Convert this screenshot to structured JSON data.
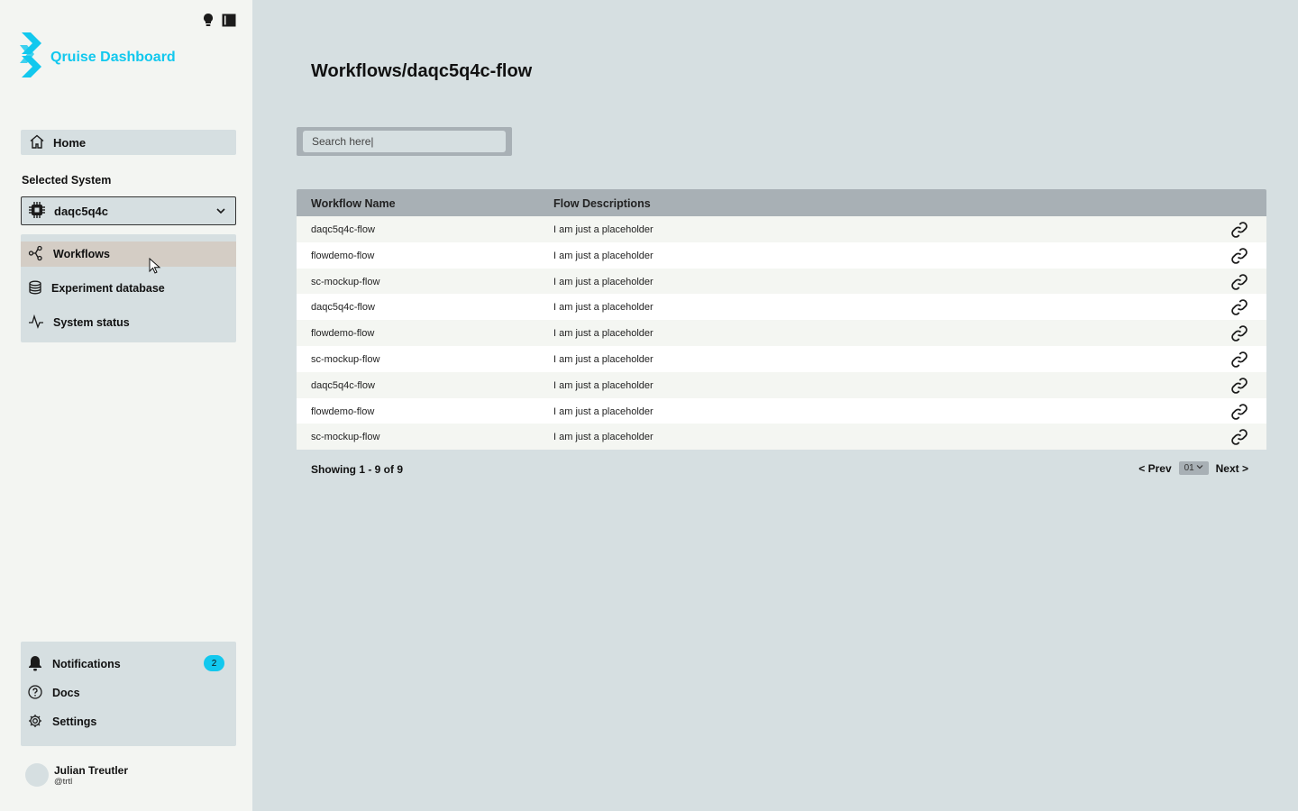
{
  "app": {
    "title": "Qruise Dashboard",
    "brand_color": "#12c8ee"
  },
  "top_icons": [
    "lightbulb-icon",
    "sidebar-toggle-icon"
  ],
  "sidebar": {
    "home_label": "Home",
    "selected_system_label": "Selected System",
    "selected_system_value": "daqc5q4c",
    "nav": [
      {
        "label": "Workflows",
        "icon": "workflow-icon",
        "active": true
      },
      {
        "label": "Experiment database",
        "icon": "database-icon",
        "active": false
      },
      {
        "label": "System status",
        "icon": "activity-icon",
        "active": false
      }
    ],
    "bottom": [
      {
        "label": "Notifications",
        "icon": "bell-icon",
        "badge": "2"
      },
      {
        "label": "Docs",
        "icon": "help-icon"
      },
      {
        "label": "Settings",
        "icon": "gear-icon"
      }
    ],
    "user": {
      "name": "Julian Treutler",
      "handle": "@trtl"
    }
  },
  "main": {
    "title": "Workflows/daqc5q4c-flow",
    "search": {
      "placeholder": "Search here|"
    },
    "table": {
      "headers": [
        "Workflow Name",
        "Flow Descriptions"
      ],
      "rows": [
        {
          "name": "daqc5q4c-flow",
          "desc": "I am just a placeholder"
        },
        {
          "name": "flowdemo-flow",
          "desc": "I am just a placeholder"
        },
        {
          "name": "sc-mockup-flow",
          "desc": "I am just a placeholder"
        },
        {
          "name": "daqc5q4c-flow",
          "desc": "I am just a placeholder"
        },
        {
          "name": "flowdemo-flow",
          "desc": "I am just a placeholder"
        },
        {
          "name": "sc-mockup-flow",
          "desc": "I am just a placeholder"
        },
        {
          "name": "daqc5q4c-flow",
          "desc": "I am just a placeholder"
        },
        {
          "name": "flowdemo-flow",
          "desc": "I am just a placeholder"
        },
        {
          "name": "sc-mockup-flow",
          "desc": "I am just a placeholder"
        }
      ]
    },
    "footer": {
      "showing": "Showing 1 - 9 of 9",
      "prev": "< Prev",
      "page": "01",
      "next": "Next >"
    }
  }
}
